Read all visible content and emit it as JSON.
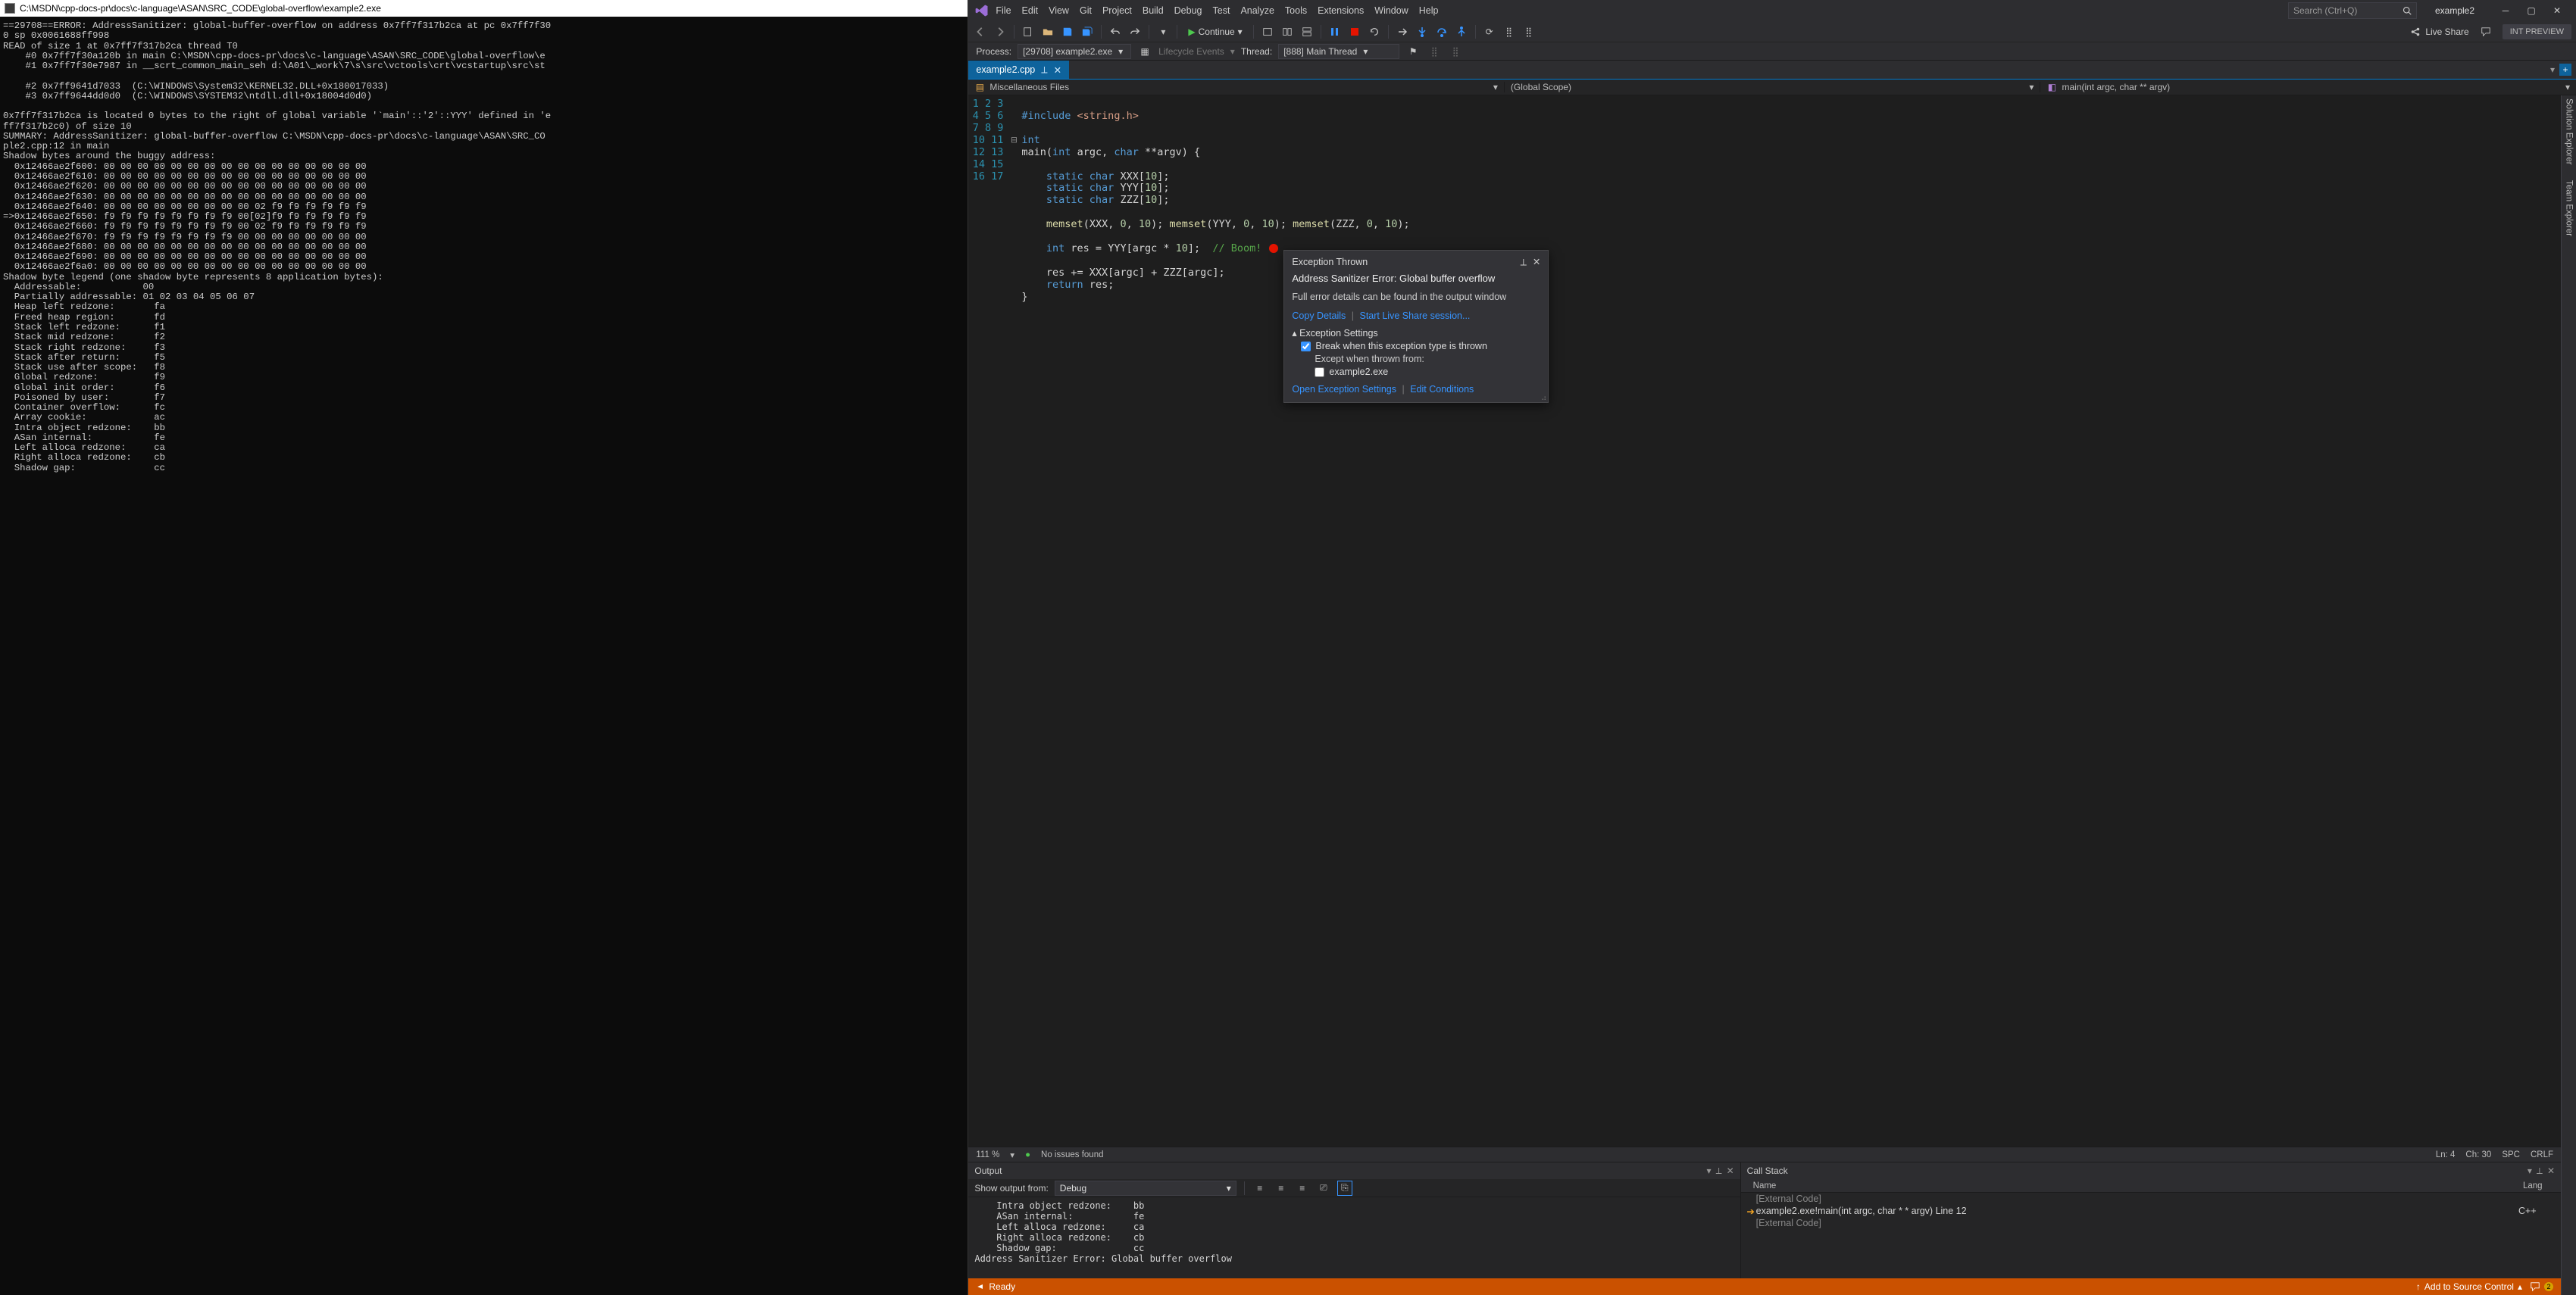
{
  "console": {
    "title": "C:\\MSDN\\cpp-docs-pr\\docs\\c-language\\ASAN\\SRC_CODE\\global-overflow\\example2.exe",
    "body": "==29708==ERROR: AddressSanitizer: global-buffer-overflow on address 0x7ff7f317b2ca at pc 0x7ff7f30\n0 sp 0x0061688ff998\nREAD of size 1 at 0x7ff7f317b2ca thread T0\n    #0 0x7ff7f30a120b in main C:\\MSDN\\cpp-docs-pr\\docs\\c-language\\ASAN\\SRC_CODE\\global-overflow\\e\n    #1 0x7ff7f30e7987 in __scrt_common_main_seh d:\\A01\\_work\\7\\s\\src\\vctools\\crt\\vcstartup\\src\\st\n\n    #2 0x7ff9641d7033  (C:\\WINDOWS\\System32\\KERNEL32.DLL+0x180017033)\n    #3 0x7ff9644dd0d0  (C:\\WINDOWS\\SYSTEM32\\ntdll.dll+0x18004d0d0)\n\n0x7ff7f317b2ca is located 0 bytes to the right of global variable '`main'::'2'::YYY' defined in 'e\nff7f317b2c0) of size 10\nSUMMARY: AddressSanitizer: global-buffer-overflow C:\\MSDN\\cpp-docs-pr\\docs\\c-language\\ASAN\\SRC_CO\nple2.cpp:12 in main\nShadow bytes around the buggy address:\n  0x12466ae2f600: 00 00 00 00 00 00 00 00 00 00 00 00 00 00 00 00\n  0x12466ae2f610: 00 00 00 00 00 00 00 00 00 00 00 00 00 00 00 00\n  0x12466ae2f620: 00 00 00 00 00 00 00 00 00 00 00 00 00 00 00 00\n  0x12466ae2f630: 00 00 00 00 00 00 00 00 00 00 00 00 00 00 00 00\n  0x12466ae2f640: 00 00 00 00 00 00 00 00 00 02 f9 f9 f9 f9 f9 f9\n=>0x12466ae2f650: f9 f9 f9 f9 f9 f9 f9 f9 00[02]f9 f9 f9 f9 f9 f9\n  0x12466ae2f660: f9 f9 f9 f9 f9 f9 f9 f9 00 02 f9 f9 f9 f9 f9 f9\n  0x12466ae2f670: f9 f9 f9 f9 f9 f9 f9 f9 00 00 00 00 00 00 00 00\n  0x12466ae2f680: 00 00 00 00 00 00 00 00 00 00 00 00 00 00 00 00\n  0x12466ae2f690: 00 00 00 00 00 00 00 00 00 00 00 00 00 00 00 00\n  0x12466ae2f6a0: 00 00 00 00 00 00 00 00 00 00 00 00 00 00 00 00\nShadow byte legend (one shadow byte represents 8 application bytes):\n  Addressable:           00\n  Partially addressable: 01 02 03 04 05 06 07\n  Heap left redzone:       fa\n  Freed heap region:       fd\n  Stack left redzone:      f1\n  Stack mid redzone:       f2\n  Stack right redzone:     f3\n  Stack after return:      f5\n  Stack use after scope:   f8\n  Global redzone:          f9\n  Global init order:       f6\n  Poisoned by user:        f7\n  Container overflow:      fc\n  Array cookie:            ac\n  Intra object redzone:    bb\n  ASan internal:           fe\n  Left alloca redzone:     ca\n  Right alloca redzone:    cb\n  Shadow gap:              cc"
  },
  "vs": {
    "menus": [
      "File",
      "Edit",
      "View",
      "Git",
      "Project",
      "Build",
      "Debug",
      "Test",
      "Analyze",
      "Tools",
      "Extensions",
      "Window",
      "Help"
    ],
    "search_placeholder": "Search (Ctrl+Q)",
    "solution": "example2",
    "int_preview": "INT PREVIEW",
    "toolbar": {
      "continue": "Continue",
      "live_share": "Live Share"
    },
    "procrow": {
      "process_label": "Process:",
      "process_value": "[29708] example2.exe",
      "lifecycle": "Lifecycle Events",
      "thread_label": "Thread:",
      "thread_value": "[888] Main Thread"
    },
    "tab": {
      "name": "example2.cpp"
    },
    "navbar": {
      "a": "Miscellaneous Files",
      "b": "(Global Scope)",
      "c": "main(int argc, char ** argv)"
    },
    "code": {
      "lines": [
        "1",
        "2",
        "3",
        "4",
        "5",
        "6",
        "7",
        "8",
        "9",
        "10",
        "11",
        "12",
        "13",
        "14",
        "15",
        "16",
        "17"
      ],
      "l1a": "#include ",
      "l1b": "<string.h>",
      "l3": "int",
      "l4a": "main",
      "l4b": "(",
      "l4c": "int",
      "l4d": " argc, ",
      "l4e": "char",
      "l4f": " **argv) {",
      "l6a": "static char",
      "l6b": " XXX[",
      "l6c": "10",
      "l6d": "];",
      "l7a": "static char",
      "l7b": " YYY[",
      "l7c": "10",
      "l7d": "];",
      "l8a": "static char",
      "l8b": " ZZZ[",
      "l8c": "10",
      "l8d": "];",
      "l10a": "memset",
      "l10b": "(XXX, ",
      "l10c": "0",
      "l10d": ", ",
      "l10e": "10",
      "l10f": "); ",
      "l10g": "memset",
      "l10h": "(YYY, ",
      "l10i": "0",
      "l10j": ", ",
      "l10k": "10",
      "l10l": "); ",
      "l10m": "memset",
      "l10n": "(ZZZ, ",
      "l10o": "0",
      "l10p": ", ",
      "l10q": "10",
      "l10r": ");",
      "l12a": "int",
      "l12b": " res = YYY[argc * ",
      "l12c": "10",
      "l12d": "];  ",
      "l12e": "// Boom!",
      "l14a": "res += XXX[argc] + ZZZ[argc];",
      "l15a": "return",
      "l15b": " res;",
      "l16": "}"
    },
    "ed_status": {
      "zoom": "111 %",
      "issues": "No issues found",
      "ln": "Ln: 4",
      "ch": "Ch: 30",
      "spc": "SPC",
      "crlf": "CRLF"
    },
    "exc": {
      "title": "Exception Thrown",
      "msg": "Address Sanitizer Error: Global buffer overflow",
      "sub": "Full error details can be found in the output window",
      "copy": "Copy Details",
      "live": "Start Live Share session...",
      "settings_hd": "Exception Settings",
      "break_chk": "Break when this exception type is thrown",
      "except_label": "Except when thrown from:",
      "except_item": "example2.exe",
      "open": "Open Exception Settings",
      "edit": "Edit Conditions"
    },
    "output": {
      "title": "Output",
      "show_label": "Show output from:",
      "show_value": "Debug",
      "body": "    Intra object redzone:    bb\n    ASan internal:           fe\n    Left alloca redzone:     ca\n    Right alloca redzone:    cb\n    Shadow gap:              cc\nAddress Sanitizer Error: Global buffer overflow"
    },
    "callstack": {
      "title": "Call Stack",
      "col_name": "Name",
      "col_lang": "Lang",
      "rows": [
        {
          "name": "[External Code]",
          "lang": "",
          "grey": true,
          "arrow": false
        },
        {
          "name": "example2.exe!main(int argc, char * * argv) Line 12",
          "lang": "C++",
          "grey": false,
          "arrow": true
        },
        {
          "name": "[External Code]",
          "lang": "",
          "grey": true,
          "arrow": false
        }
      ]
    },
    "status": {
      "ready": "Ready",
      "add_src": "Add to Source Control"
    },
    "side_tabs": [
      "Solution Explorer",
      "Team Explorer"
    ]
  }
}
